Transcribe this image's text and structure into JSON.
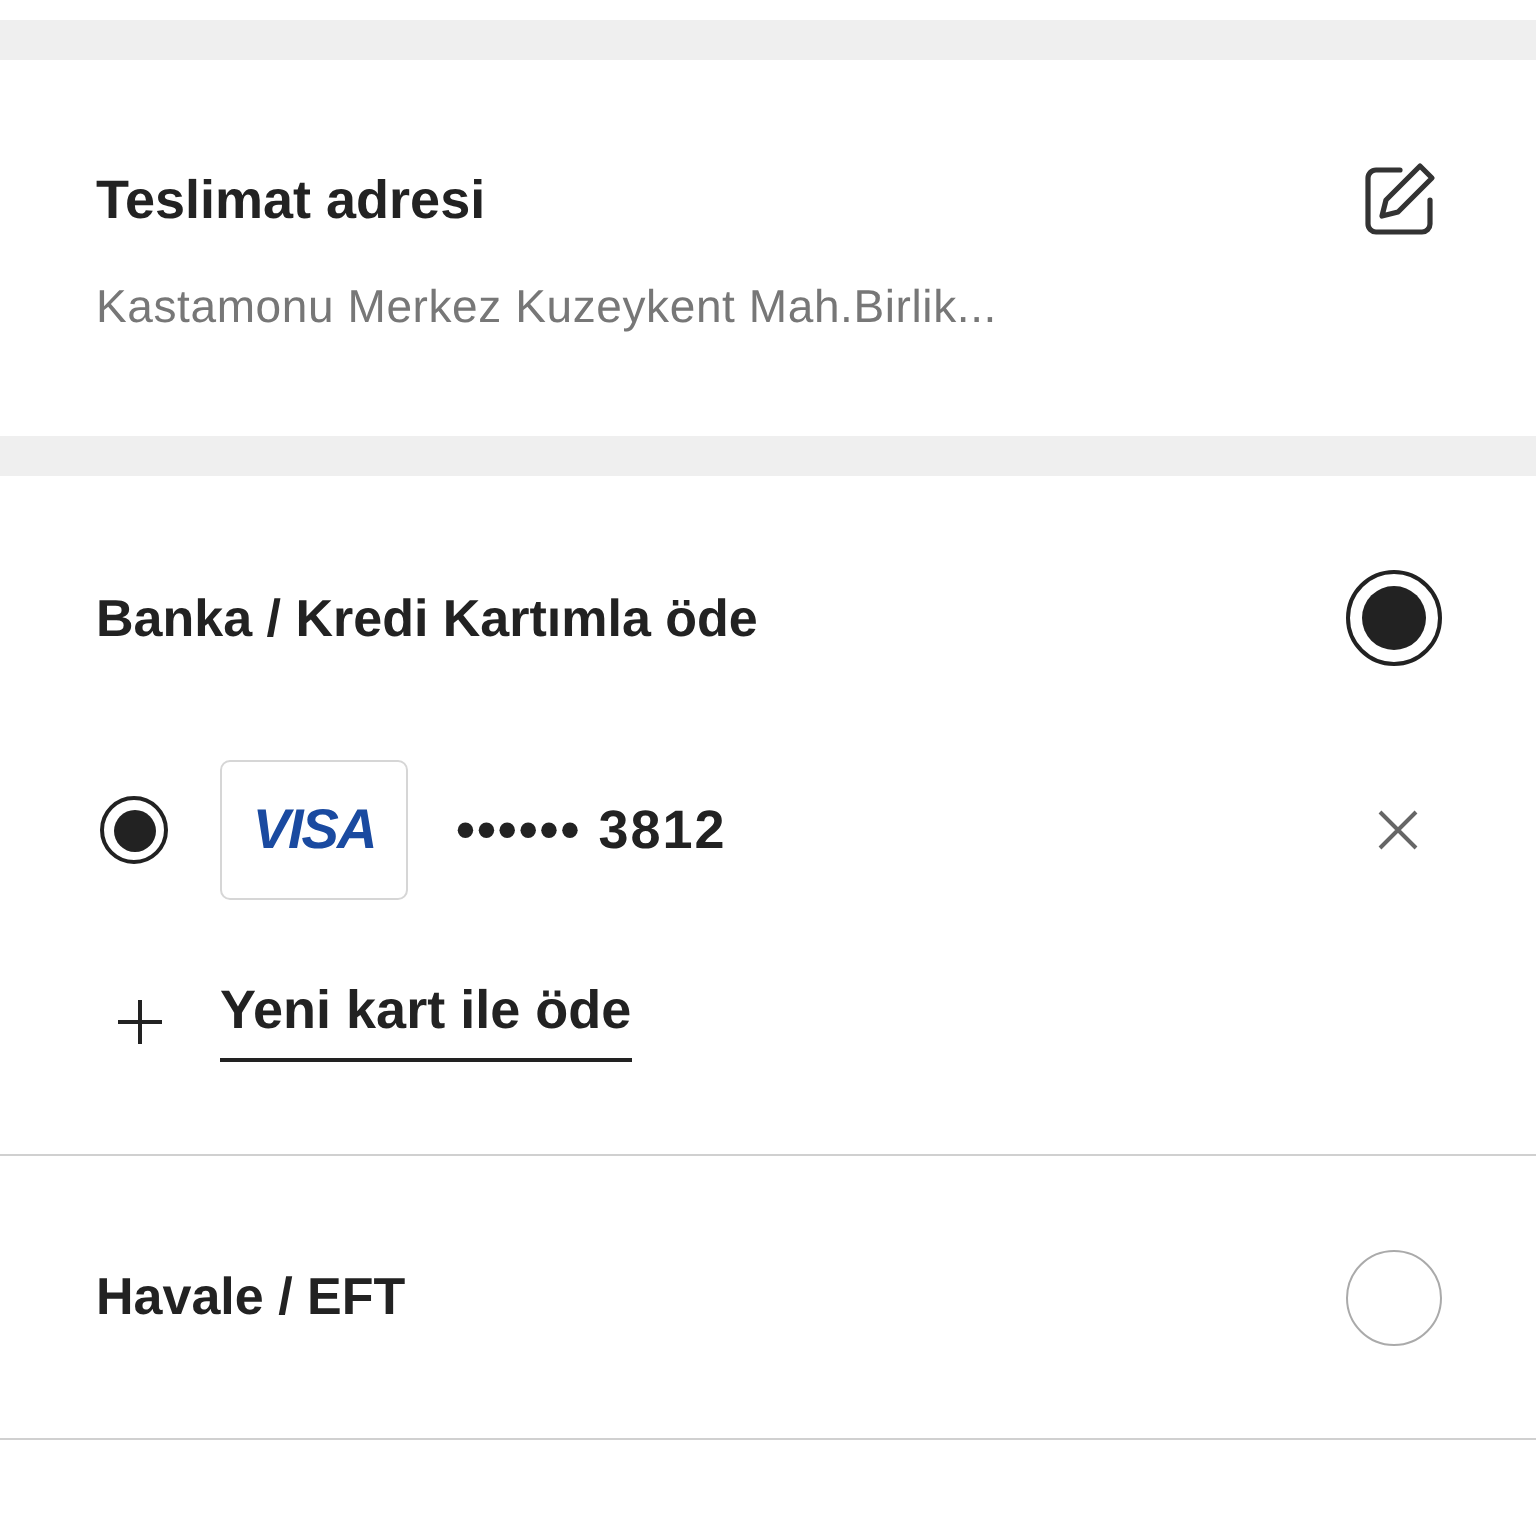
{
  "address": {
    "title": "Teslimat adresi",
    "text": "Kastamonu Merkez Kuzeykent Mah.Birlik..."
  },
  "payment_methods": [
    {
      "kind": "card",
      "title": "Banka / Kredi Kartımla öde",
      "selected": true,
      "cards": [
        {
          "brand": "VISA",
          "number": "•••••• 3812",
          "selected": true
        }
      ],
      "add_card": "Yeni kart ile öde"
    },
    {
      "kind": "transfer",
      "title": "Havale / EFT",
      "selected": false
    }
  ]
}
